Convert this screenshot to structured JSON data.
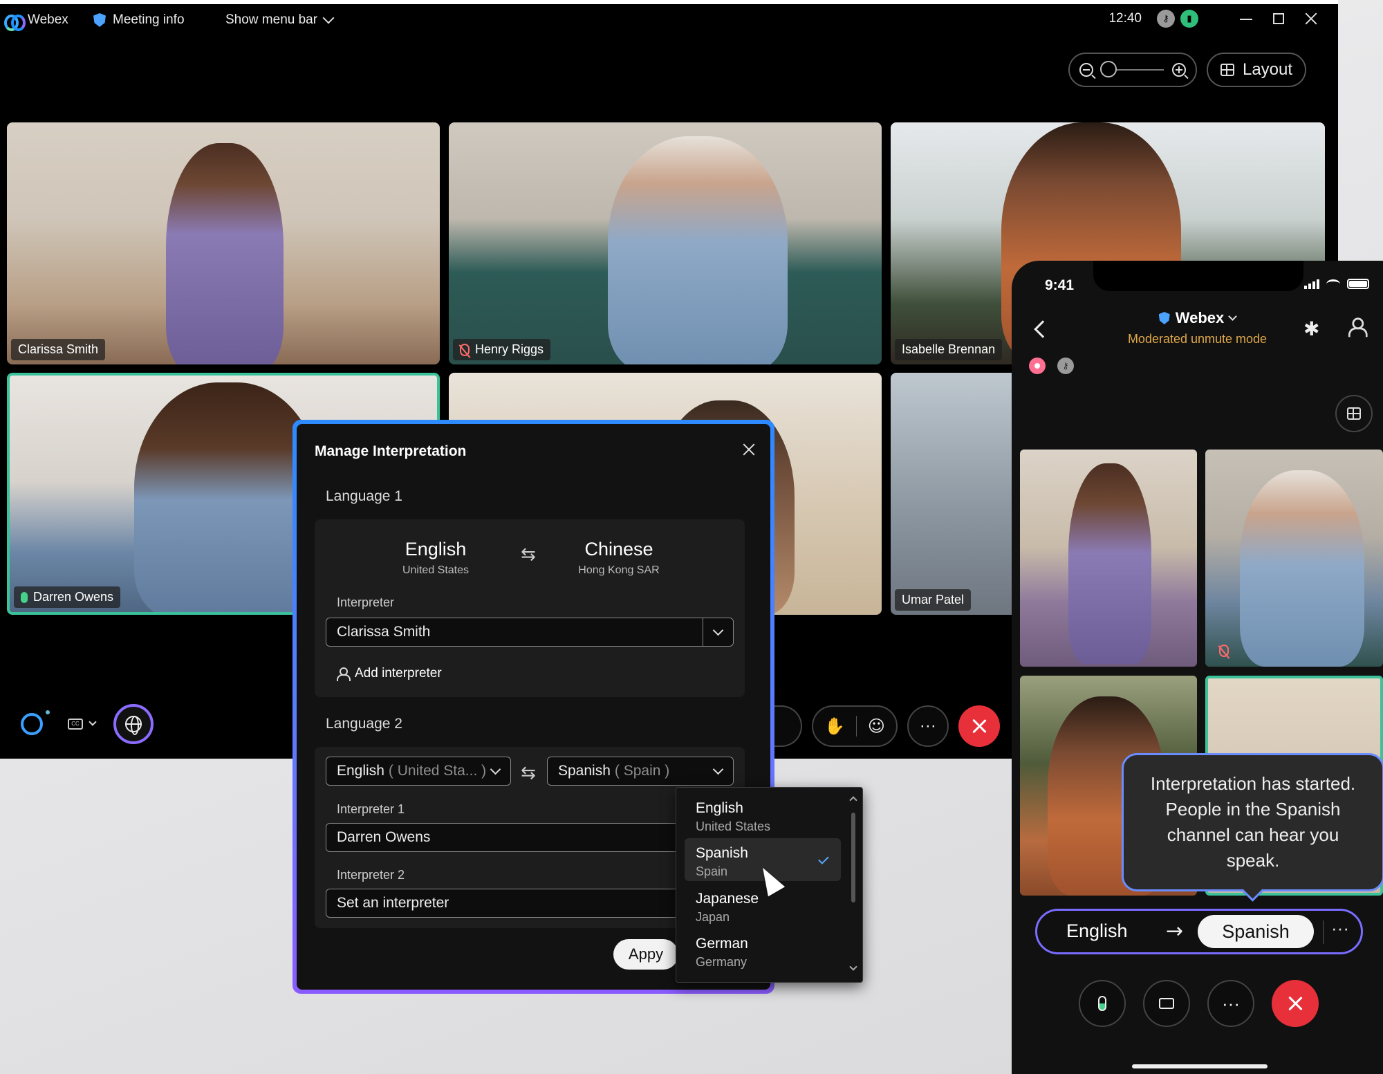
{
  "titlebar": {
    "app_name": "Webex",
    "meeting_info": "Meeting info",
    "show_menu_bar": "Show menu bar",
    "time": "12:40"
  },
  "toolbar": {
    "layout_label": "Layout"
  },
  "participants": [
    {
      "name": "Clarissa Smith",
      "muted": false
    },
    {
      "name": "Henry Riggs",
      "muted": true
    },
    {
      "name": "Isabelle Brennan",
      "muted": false
    },
    {
      "name": "Darren Owens",
      "speaking": true
    },
    {
      "name": "",
      "muted": false
    },
    {
      "name": "Umar Patel",
      "muted": false
    }
  ],
  "controls": {
    "more_label": "···"
  },
  "dialog": {
    "title": "Manage Interpretation",
    "language1": {
      "label": "Language 1",
      "from": {
        "name": "English",
        "region": "United States"
      },
      "to": {
        "name": "Chinese",
        "region": "Hong Kong SAR"
      },
      "interpreter_label": "Interpreter",
      "interpreter_value": "Clarissa Smith",
      "add_interpreter": "Add interpreter"
    },
    "language2": {
      "label": "Language 2",
      "from_name": "English",
      "from_region": "( United Sta... )",
      "to_name": "Spanish",
      "to_region": "( Spain )",
      "interpreter1_label": "Interpreter 1",
      "interpreter1_value": "Darren Owens",
      "interpreter2_label": "Interpreter 2",
      "interpreter2_placeholder": "Set an interpreter"
    },
    "apply_label": "Appy"
  },
  "dropdown": {
    "options": [
      {
        "name": "English",
        "region": "United States",
        "selected": false
      },
      {
        "name": "Spanish",
        "region": "Spain",
        "selected": true
      },
      {
        "name": "Japanese",
        "region": "Japan",
        "selected": false
      },
      {
        "name": "German",
        "region": "Germany",
        "selected": false
      }
    ]
  },
  "phone": {
    "time": "9:41",
    "app_name": "Webex",
    "mode": "Moderated unmute mode",
    "tooltip": "Interpretation has started. People in the Spanish channel can hear you speak.",
    "lang_from": "English",
    "lang_to": "Spanish",
    "more_label": "···"
  },
  "colors": {
    "accent_blue": "#2d8bff",
    "accent_purple": "#8a5cff",
    "active_speaker": "#3cc29a",
    "end_call": "#e8303a",
    "moderated_mode": "#e0a84a"
  }
}
